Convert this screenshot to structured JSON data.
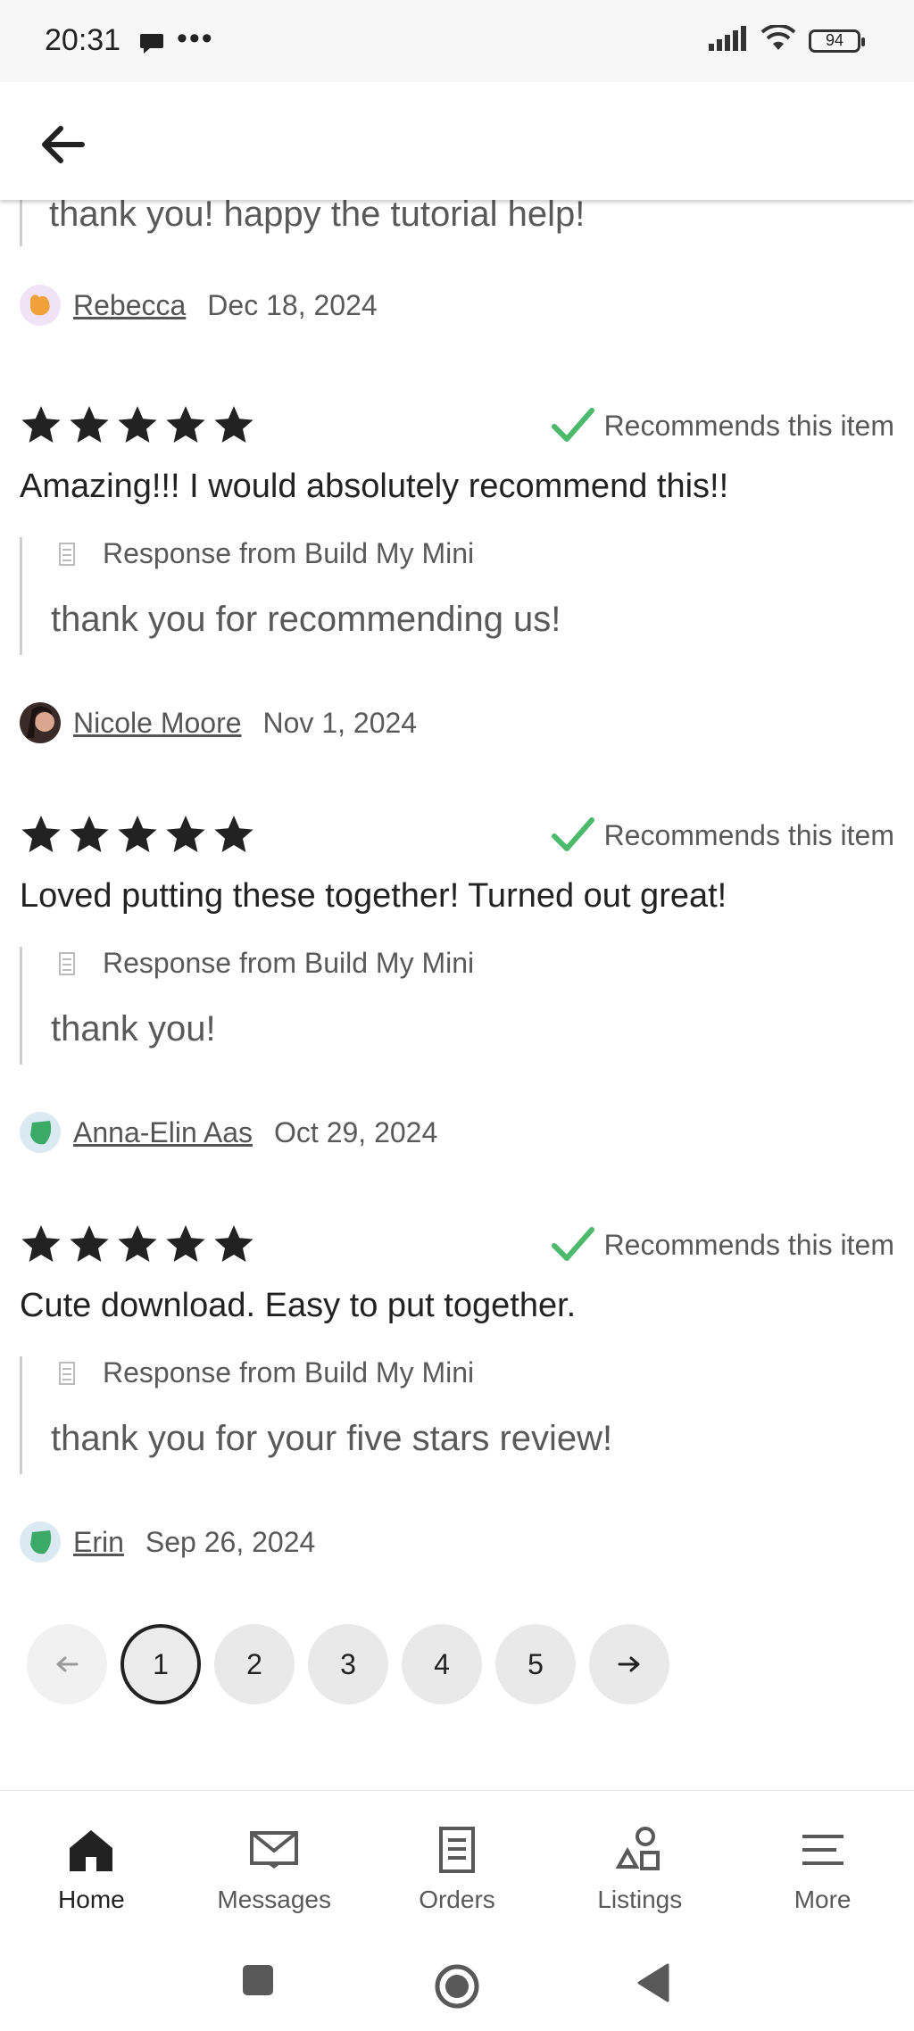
{
  "status_bar": {
    "time": "20:31",
    "battery": "94"
  },
  "header": {
    "back_icon": "arrow-left-icon"
  },
  "first_response_tail": {
    "text": "thank you! happy the tutorial help!"
  },
  "first_reviewer": {
    "name": "Rebecca",
    "date": "Dec 18, 2024"
  },
  "reviews": [
    {
      "rating": 5,
      "recommend_label": "Recommends this item",
      "text": "Amazing!!! I would absolutely recommend this!!",
      "response_from": "Response from Build My Mini",
      "response_text": "thank you for recommending us!",
      "reviewer": "Nicole Moore",
      "date": "Nov 1, 2024"
    },
    {
      "rating": 5,
      "recommend_label": "Recommends this item",
      "text": "Loved putting these together! Turned out great!",
      "response_from": "Response from Build My Mini",
      "response_text": "thank you!",
      "reviewer": "Anna-Elin Aas",
      "date": "Oct 29, 2024"
    },
    {
      "rating": 5,
      "recommend_label": "Recommends this item",
      "text": "Cute download. Easy to put together.",
      "response_from": "Response from Build My Mini",
      "response_text": "thank you for your five stars review!",
      "reviewer": "Erin",
      "date": "Sep 26, 2024"
    }
  ],
  "pagination": {
    "pages": [
      "1",
      "2",
      "3",
      "4",
      "5"
    ],
    "current": "1"
  },
  "bottom_nav": [
    {
      "label": "Home",
      "icon": "home-icon",
      "active": true
    },
    {
      "label": "Messages",
      "icon": "envelope-icon",
      "active": false
    },
    {
      "label": "Orders",
      "icon": "document-icon",
      "active": false
    },
    {
      "label": "Listings",
      "icon": "shapes-icon",
      "active": false
    },
    {
      "label": "More",
      "icon": "menu-icon",
      "active": false
    }
  ],
  "colors": {
    "check": "#4cb96d",
    "text_primary": "#222222",
    "text_secondary": "#595959"
  }
}
